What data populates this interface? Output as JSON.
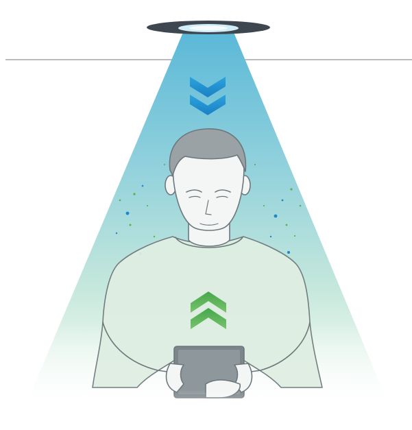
{
  "palette": {
    "background": "#ffffff",
    "ceiling_line": "#b9bcbf",
    "lamp_ring": "#3e4650",
    "lamp_lens": "#d6f1fa",
    "beam_top": "#5ab8d8",
    "beam_mid": "#a6dcd6",
    "beam_bottom": "#dff1e3",
    "down_arrows": "#1e8fd0",
    "up_arrows": "#48a84e",
    "skin": "#f4f6f6",
    "hair": "#9aa2a6",
    "sweater": "#dfeee2",
    "outline": "#6d777b",
    "tablet": "#7c858a",
    "dot_blue": "#1d86c6",
    "dot_green": "#5ab24a"
  },
  "icons": [
    "ceiling-lamp-icon",
    "chevron-double-down-icon",
    "chevron-double-up-icon",
    "person-with-tablet-icon"
  ]
}
